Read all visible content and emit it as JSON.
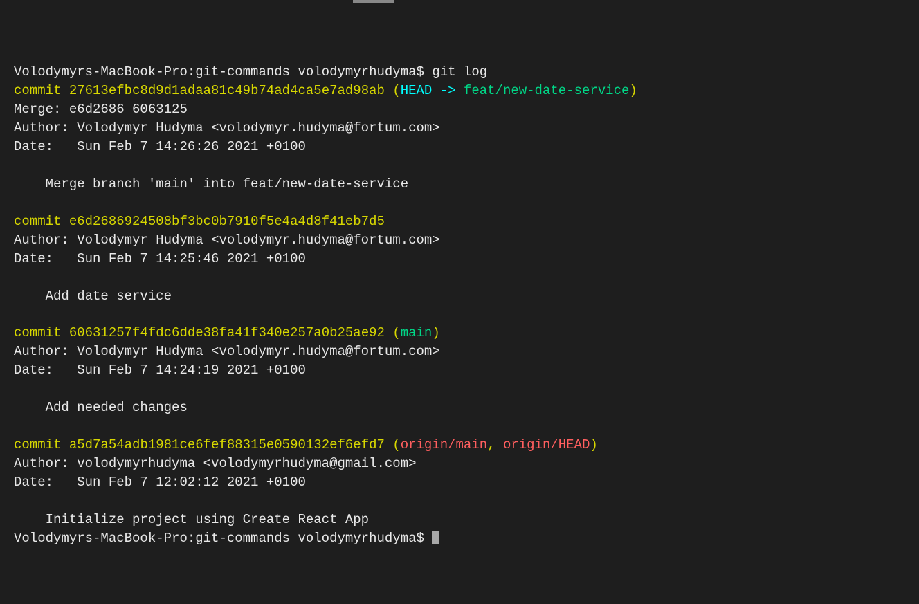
{
  "prompt1": "Volodymyrs-MacBook-Pro:git-commands volodymyrhudyma$ ",
  "command": "git log",
  "commits": [
    {
      "commit_label": "commit ",
      "hash": "27613efbc8d9d1adaa81c49b74ad4ca5e7ad98ab",
      "refs_open": " (",
      "refs_head": "HEAD -> ",
      "refs_branch": "feat/new-date-service",
      "refs_close": ")",
      "merge": "Merge: e6d2686 6063125",
      "author": "Author: Volodymyr Hudyma <volodymyr.hudyma@fortum.com>",
      "date": "Date:   Sun Feb 7 14:26:26 2021 +0100",
      "message": "    Merge branch 'main' into feat/new-date-service"
    },
    {
      "commit_label": "commit ",
      "hash": "e6d2686924508bf3bc0b7910f5e4a4d8f41eb7d5",
      "author": "Author: Volodymyr Hudyma <volodymyr.hudyma@fortum.com>",
      "date": "Date:   Sun Feb 7 14:25:46 2021 +0100",
      "message": "    Add date service"
    },
    {
      "commit_label": "commit ",
      "hash": "60631257f4fdc6dde38fa41f340e257a0b25ae92",
      "refs_open": " (",
      "refs_main": "main",
      "refs_close": ")",
      "author": "Author: Volodymyr Hudyma <volodymyr.hudyma@fortum.com>",
      "date": "Date:   Sun Feb 7 14:24:19 2021 +0100",
      "message": "    Add needed changes"
    },
    {
      "commit_label": "commit ",
      "hash": "a5d7a54adb1981ce6fef88315e0590132ef6efd7",
      "refs_open": " (",
      "refs_remote1": "origin/main",
      "refs_sep": ", ",
      "refs_remote2": "origin/HEAD",
      "refs_close": ")",
      "author": "Author: volodymyrhudyma <volodymyrhudyma@gmail.com>",
      "date": "Date:   Sun Feb 7 12:02:12 2021 +0100",
      "message": "    Initialize project using Create React App"
    }
  ],
  "prompt2": "Volodymyrs-MacBook-Pro:git-commands volodymyrhudyma$ "
}
